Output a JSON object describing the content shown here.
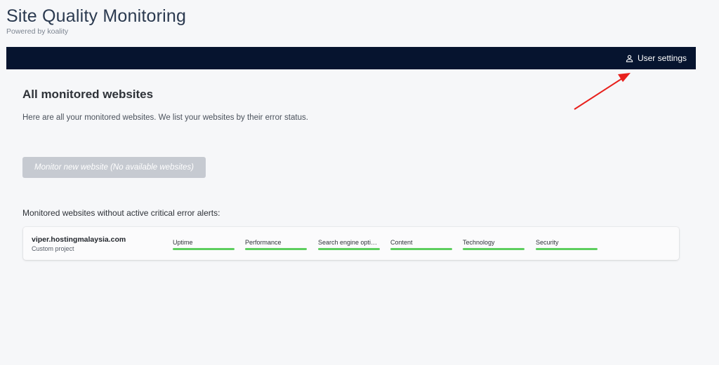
{
  "app": {
    "title": "Site Quality Monitoring",
    "subtitle": "Powered by koality"
  },
  "topbar": {
    "user_settings_label": "User settings",
    "user_icon": "user-icon",
    "background": "#06142f"
  },
  "main": {
    "title": "All monitored websites",
    "description": "Here are all your monitored websites. We list your websites by their error status.",
    "monitor_button_label": "Monitor new website (No available websites)",
    "section_label": "Monitored websites without active critical error alerts:"
  },
  "sites": [
    {
      "name": "viper.hostingmalaysia.com",
      "project": "Custom project",
      "metrics": [
        {
          "label": "Uptime",
          "status_color": "#5dce5e"
        },
        {
          "label": "Performance",
          "status_color": "#5dce5e"
        },
        {
          "label": "Search engine optim...",
          "status_color": "#5dce5e"
        },
        {
          "label": "Content",
          "status_color": "#5dce5e"
        },
        {
          "label": "Technology",
          "status_color": "#5dce5e"
        },
        {
          "label": "Security",
          "status_color": "#5dce5e"
        }
      ]
    }
  ],
  "annotation": {
    "arrow_color": "#e8201c"
  }
}
